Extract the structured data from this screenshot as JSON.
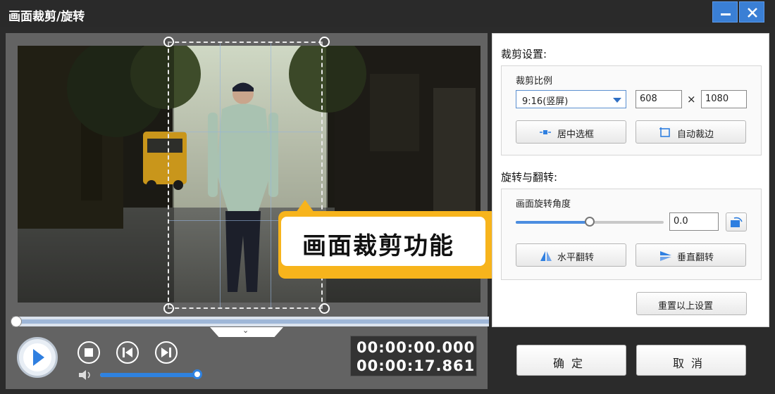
{
  "window": {
    "title": "画面裁剪/旋转"
  },
  "colors": {
    "accent": "#3a7fd5",
    "callout": "#f7b41c",
    "volume": "#2f82e0"
  },
  "preview": {
    "callout_text": "画面裁剪功能",
    "timeline_progress": 0.0,
    "collapse_icon": "chevron-down-icon"
  },
  "player": {
    "volume_level": 0.97,
    "current_time": "00:00:00.000",
    "total_time": "00:00:17.861"
  },
  "crop": {
    "section_title": "裁剪设置:",
    "ratio_label": "裁剪比例",
    "ratio_value": "9:16(竖屏)",
    "width": "608",
    "times": "×",
    "height": "1080",
    "center_button": "居中选框",
    "auto_button": "自动裁边"
  },
  "rotate": {
    "section_title": "旋转与翻转:",
    "angle_label": "画面旋转角度",
    "angle_value": "0.0",
    "angle_slider": 0.5,
    "flip_h_button": "水平翻转",
    "flip_v_button": "垂直翻转"
  },
  "reset_button": "重置以上设置",
  "ok_button": "确定",
  "cancel_button": "取消"
}
